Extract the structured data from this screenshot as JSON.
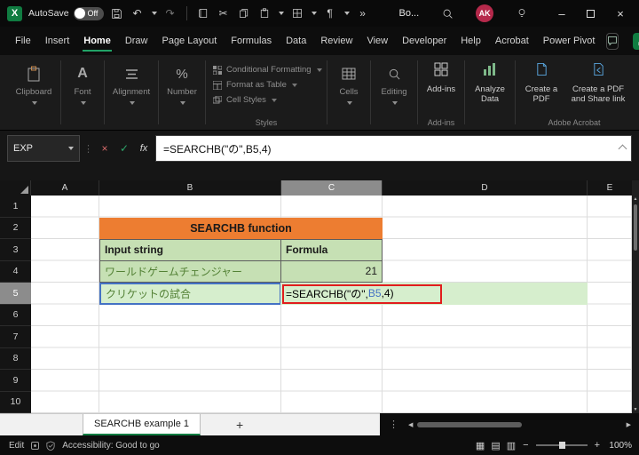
{
  "titlebar": {
    "autosave_label": "AutoSave",
    "autosave_state": "Off",
    "doc_name": "Bo...",
    "avatar_initials": "AK"
  },
  "icons": {
    "logo": "X",
    "undo": "↶",
    "redo": "↷",
    "cut": "✂",
    "paragraph": "¶",
    "more": "»",
    "minimize": "–",
    "close": "×",
    "dots_v": "⋮",
    "font": "A",
    "number": "%",
    "fx": "fx",
    "cancel": "×",
    "enter": "✓",
    "scroll_left": "◀",
    "scroll_right": "▶",
    "scroll_up": "▲",
    "scroll_down": "▼",
    "view_normal": "▦",
    "view_layout": "▤",
    "view_break": "▥",
    "zoom_out": "−",
    "zoom_in": "+"
  },
  "menubar": {
    "items": [
      "File",
      "Insert",
      "Home",
      "Draw",
      "Page Layout",
      "Formulas",
      "Data",
      "Review",
      "View",
      "Developer",
      "Help",
      "Acrobat",
      "Power Pivot"
    ],
    "active_item": "Home"
  },
  "ribbon": {
    "clipboard_label": "Clipboard",
    "font_label": "Font",
    "alignment_label": "Alignment",
    "number_label": "Number",
    "styles_items": [
      "Conditional Formatting",
      "Format as Table",
      "Cell Styles"
    ],
    "styles_group_label": "Styles",
    "cells_label": "Cells",
    "editing_label": "Editing",
    "addins_label": "Add-ins",
    "addins_group_label": "Add-ins",
    "analyze_label": "Analyze Data",
    "pdf_button_1": "Create a PDF",
    "pdf_button_2": "Create a PDF and Share link",
    "acrobat_group_label": "Adobe Acrobat"
  },
  "formula_bar": {
    "name_box_value": "EXP",
    "formula": "=SEARCHB(\"の\",B5,4)"
  },
  "grid": {
    "columns": [
      "A",
      "B",
      "C",
      "D",
      "E"
    ],
    "rows": [
      "1",
      "2",
      "3",
      "4",
      "5",
      "6",
      "7",
      "8",
      "9",
      "10"
    ],
    "title_cell": "SEARCHB function",
    "input_header": "Input string",
    "formula_header": "Formula",
    "input_row1": "ワールドゲームチェンジャー",
    "result_row1": "21",
    "input_row2": "クリケットの試合",
    "c5_formula_pre": "=SEARCHB(\"の\",",
    "c5_formula_ref": "B5",
    "c5_formula_post": ",4)"
  },
  "sheet_tabs": {
    "active_tab": "SEARCHB example 1",
    "add_tab": "+"
  },
  "status_bar": {
    "mode": "Edit",
    "accessibility": "Accessibility: Good to go",
    "zoom_level": "100%"
  },
  "colors": {
    "accent_green": "#21a366",
    "header_orange": "#ed7d31",
    "cell_green": "#c6e0b4",
    "row5_green": "#d6eecd",
    "reference_blue": "#4472c4",
    "annotation_red": "#e11d1d",
    "japanese_text_green": "#538135",
    "avatar_red": "#b5294b"
  }
}
